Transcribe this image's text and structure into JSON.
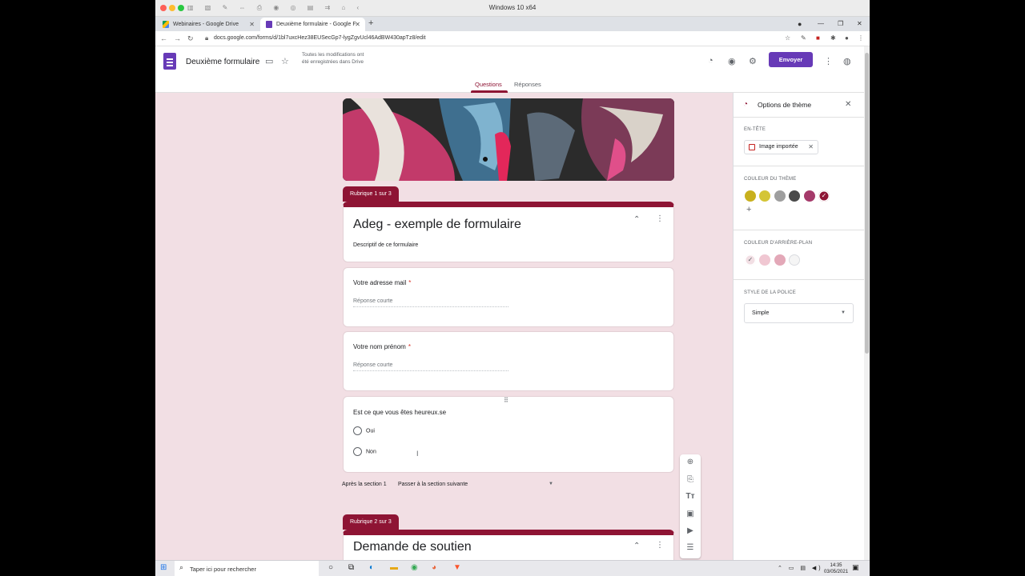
{
  "vm": {
    "title": "Windows 10 x64"
  },
  "browser": {
    "tabs": [
      {
        "label": "Webinaires - Google Drive"
      },
      {
        "label": "Deuxième formulaire - Google F"
      }
    ],
    "url": "docs.google.com/forms/d/1bl7uxcHez38EUSecGp7-lygZgvUcl46AdBW430apTz8/edit"
  },
  "header": {
    "doc_title": "Deuxième formulaire",
    "save_status": "Toutes les modifications ont été enregistrées dans Drive",
    "send_label": "Envoyer",
    "tabs": [
      {
        "label": "Questions",
        "active": true
      },
      {
        "label": "Réponses",
        "active": false
      }
    ]
  },
  "form": {
    "section1_tab": "Rubrique 1 sur 3",
    "title": "Adeg - exemple de formulaire",
    "description": "Descriptif de ce formulaire",
    "questions": [
      {
        "label": "Votre adresse mail",
        "required": "*",
        "placeholder": "Réponse courte"
      },
      {
        "label": "Votre nom prénom",
        "required": "*",
        "placeholder": "Réponse courte"
      },
      {
        "label": "Est ce que vous êtes heureux.se",
        "options": [
          "Oui",
          "Non"
        ]
      }
    ],
    "after_section_label": "Après la section 1",
    "after_section_value": "Passer à la section suivante",
    "section2_tab": "Rubrique 2 sur 3",
    "section2_title": "Demande de soutien"
  },
  "theme_panel": {
    "title": "Options de thème",
    "header_label": "EN-TÊTE",
    "header_chip": "Image importée",
    "theme_color_label": "COULEUR DU THÈME",
    "theme_colors": [
      "#c8b01e",
      "#d4c536",
      "#9e9e9e",
      "#4a4a4a",
      "#a53a6a",
      "#8e1434"
    ],
    "background_color_label": "COULEUR D'ARRIÈRE-PLAN",
    "background_colors": [
      "#f2dfe4",
      "#f0c7d2",
      "#e3a8b8",
      "#f5f5f5"
    ],
    "font_label": "STYLE DE LA POLICE",
    "font_value": "Simple"
  },
  "taskbar": {
    "search_placeholder": "Taper ici pour rechercher",
    "time": "14:35",
    "date": "03/05/2021"
  },
  "colors": {
    "accent": "#8e1434",
    "forms_purple": "#673ab7",
    "canvas_bg": "#f2dfe4"
  }
}
